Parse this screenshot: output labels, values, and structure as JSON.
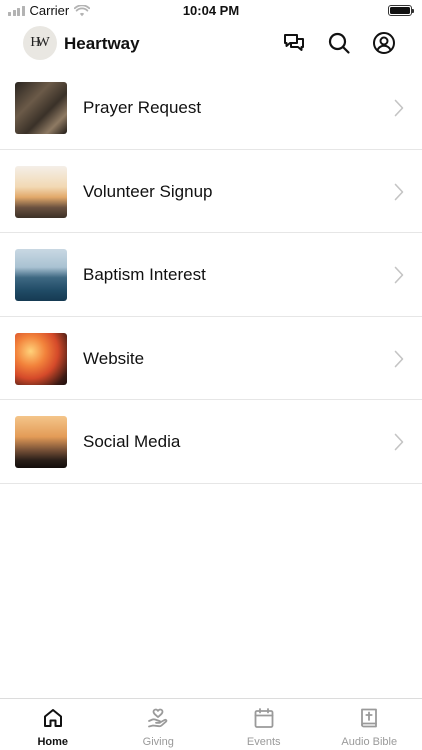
{
  "status_bar": {
    "carrier": "Carrier",
    "time": "10:04 PM"
  },
  "header": {
    "logo_text": "HW",
    "title": "Heartway",
    "icons": [
      "chat-icon",
      "search-icon",
      "account-icon"
    ]
  },
  "list": {
    "items": [
      {
        "label": "Prayer Request",
        "thumb": "prayer-thumbnail"
      },
      {
        "label": "Volunteer Signup",
        "thumb": "volunteer-thumbnail"
      },
      {
        "label": "Baptism Interest",
        "thumb": "baptism-thumbnail"
      },
      {
        "label": "Website",
        "thumb": "website-thumbnail"
      },
      {
        "label": "Social Media",
        "thumb": "social-media-thumbnail"
      }
    ]
  },
  "tabbar": {
    "tabs": [
      {
        "label": "Home",
        "icon": "home-icon",
        "active": true
      },
      {
        "label": "Giving",
        "icon": "giving-icon",
        "active": false
      },
      {
        "label": "Events",
        "icon": "calendar-icon",
        "active": false
      },
      {
        "label": "Audio Bible",
        "icon": "bible-icon",
        "active": false
      }
    ]
  },
  "colors": {
    "active_tab": "#111111",
    "inactive_tab": "#9a9a9a",
    "divider": "#e6e6e6",
    "chevron": "#c4c4c4"
  }
}
